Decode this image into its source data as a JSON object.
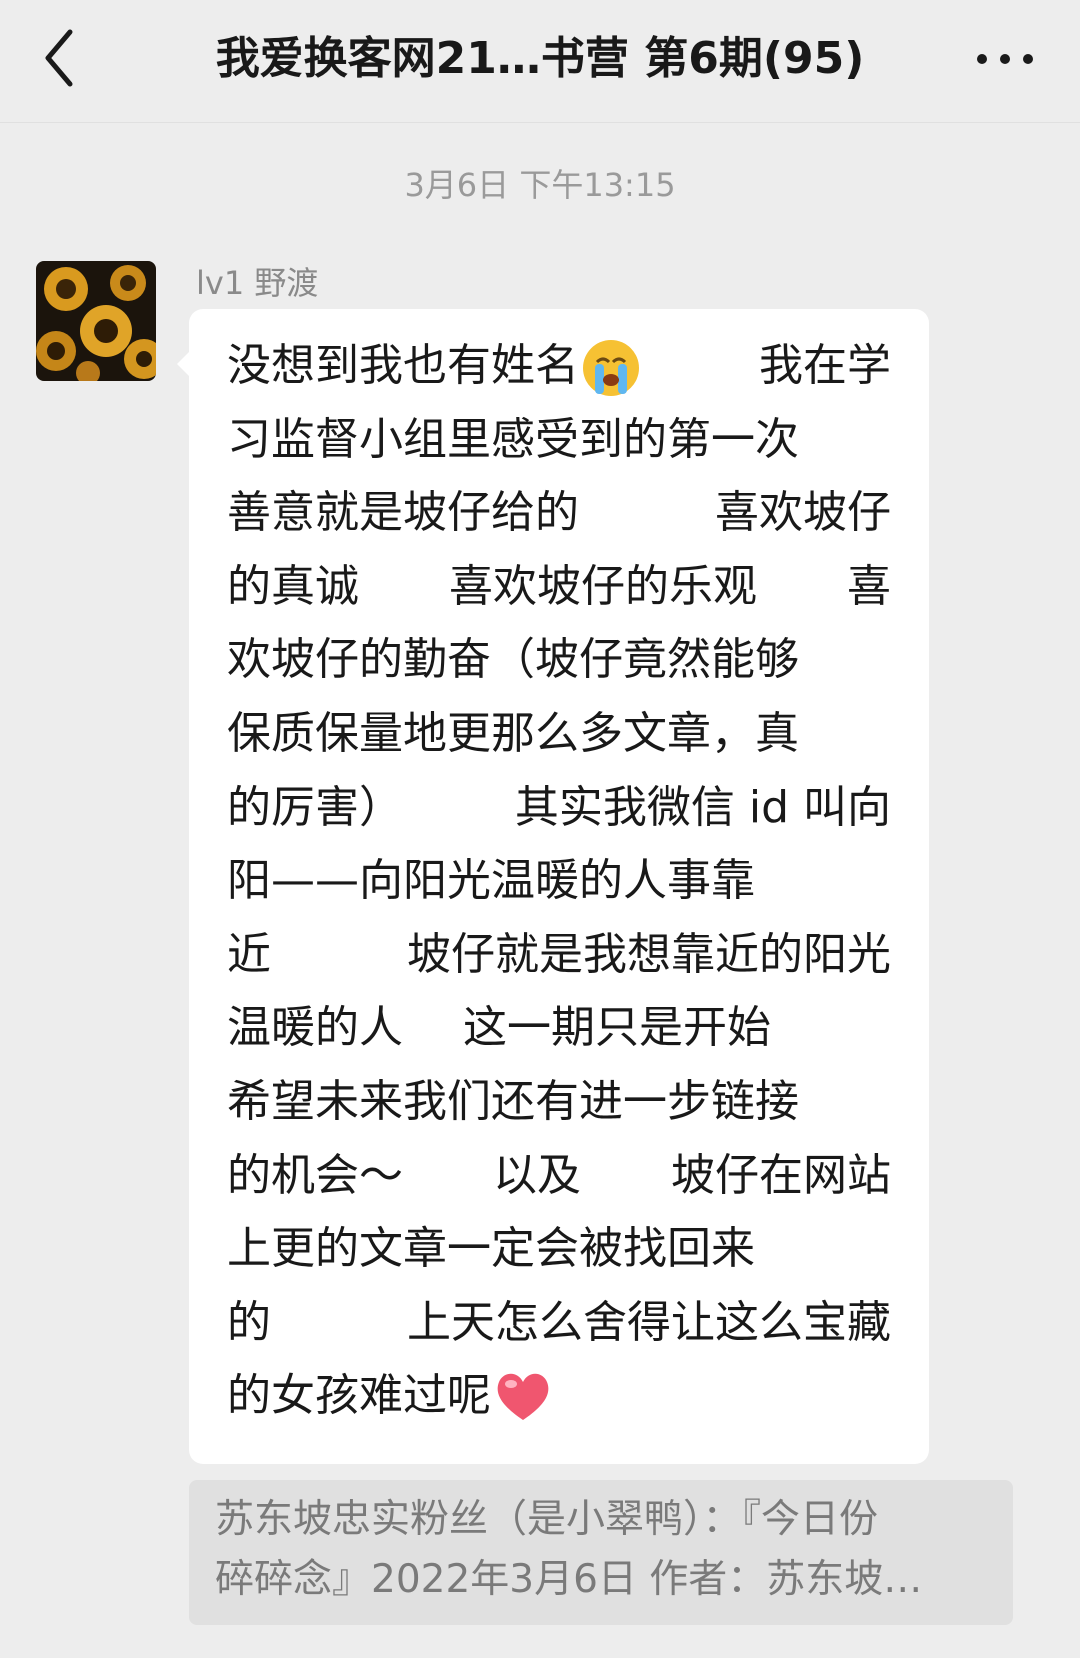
{
  "header": {
    "back_icon": "chevron-left-icon",
    "title": "我爱换客网21…书营 第6期(95)",
    "more_icon": "ellipsis-icon"
  },
  "chat": {
    "timestamp": "3月6日 下午13:15",
    "message": {
      "avatar_icon": "sunflower-avatar",
      "sender": "lv1  野渡",
      "lines": [
        [
          "没想到我也有姓名",
          "我在学"
        ],
        [
          "习监督小组里感受到的第一次"
        ],
        [
          "善意就是坡仔给的",
          "喜欢坡仔"
        ],
        [
          "的真诚",
          "喜欢坡仔的乐观",
          "喜"
        ],
        [
          "欢坡仔的勤奋（坡仔竟然能够"
        ],
        [
          "保质保量地更那么多文章，真"
        ],
        [
          "的厉害）",
          "其实我微信 id 叫向"
        ],
        [
          "阳——向阳光温暖的人事靠"
        ],
        [
          "近",
          "坡仔就是我想靠近的阳光"
        ],
        [
          "温暖的人",
          "这一期只是开始"
        ],
        [
          "希望未来我们还有进一步链接"
        ],
        [
          "的机会～",
          "以及",
          "坡仔在网站"
        ],
        [
          "上更的文章一定会被找回来"
        ],
        [
          "的",
          "上天怎么舍得让这么宝藏"
        ],
        [
          "的女孩难过呢"
        ]
      ],
      "emoji_cry": "loudly-crying-face-icon",
      "emoji_heart": "red-heart-icon"
    },
    "quote": {
      "line1": "苏东坡忠实粉丝（是小翠鸭）：『今日份",
      "line2": "碎碎念』2022年3月6日 作者：苏东坡…"
    }
  }
}
